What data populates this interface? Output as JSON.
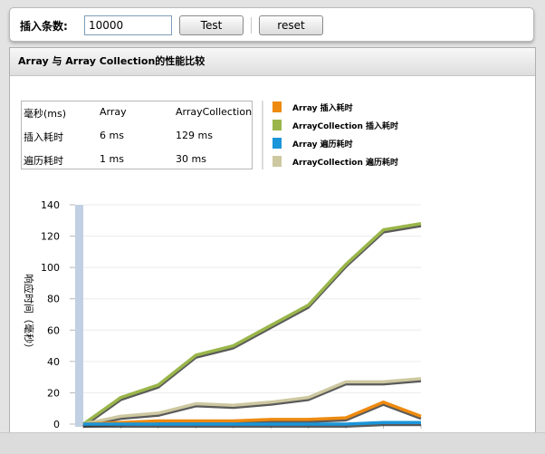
{
  "toolbar": {
    "label": "插入条数:",
    "input_value": "10000",
    "test_label": "Test",
    "reset_label": "reset"
  },
  "panel": {
    "title": "Array 与 Array Collection的性能比较"
  },
  "perf_table": {
    "header": [
      "毫秒(ms)",
      "Array",
      "ArrayCollection"
    ],
    "rows": [
      [
        "插入耗时",
        "6 ms",
        "129 ms"
      ],
      [
        "遍历耗时",
        "1 ms",
        "30 ms"
      ]
    ]
  },
  "legend": [
    {
      "label": "Array 插入耗时",
      "color": "#ee8a0f"
    },
    {
      "label": "ArrayCollection 插入耗时",
      "color": "#9ab64b"
    },
    {
      "label": "Array 遍历耗时",
      "color": "#1b95d9"
    },
    {
      "label": "ArrayCollection 遍历耗时",
      "color": "#cdc8a0"
    }
  ],
  "chart_data": {
    "type": "line",
    "ylabel": "响应时间（毫秒）",
    "xlabel": "",
    "ylim": [
      0,
      140
    ],
    "yticks": [
      0,
      20,
      40,
      60,
      80,
      100,
      120,
      140
    ],
    "x": [
      0,
      1,
      2,
      3,
      4,
      5,
      6,
      7,
      8,
      9
    ],
    "series": [
      {
        "name": "ArrayCollection 插入耗时",
        "color": "#9ab64b",
        "values": [
          0,
          17,
          25,
          44,
          50,
          63,
          76,
          102,
          124,
          128
        ]
      },
      {
        "name": "ArrayCollection 遍历耗时",
        "color": "#cdc8a0",
        "values": [
          0,
          5,
          7,
          13,
          12,
          14,
          17,
          27,
          27,
          29
        ]
      },
      {
        "name": "Array 插入耗时",
        "color": "#ee8a0f",
        "values": [
          0,
          1,
          2,
          2,
          2,
          3,
          3,
          4,
          14,
          5
        ]
      },
      {
        "name": "Array 遍历耗时",
        "color": "#1b95d9",
        "values": [
          0,
          0,
          0,
          0,
          0,
          0,
          0,
          0,
          1,
          1
        ]
      }
    ]
  }
}
